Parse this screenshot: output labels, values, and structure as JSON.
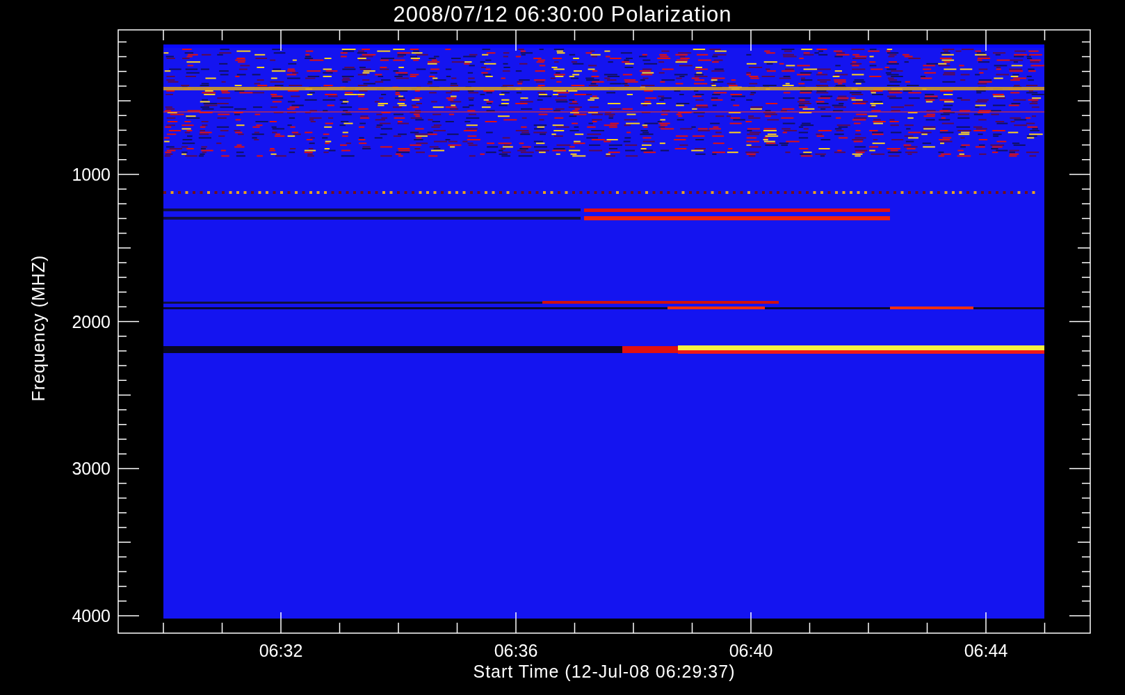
{
  "title": "2008/07/12 06:30:00 Polarization",
  "y_axis": {
    "label": "Frequency (MHZ)",
    "tick_labels": [
      "1000",
      "2000",
      "3000",
      "4000"
    ]
  },
  "x_axis": {
    "label": "Start Time (12-Jul-08 06:29:37)",
    "tick_labels": [
      "06:32",
      "06:36",
      "06:40",
      "06:44"
    ]
  }
}
